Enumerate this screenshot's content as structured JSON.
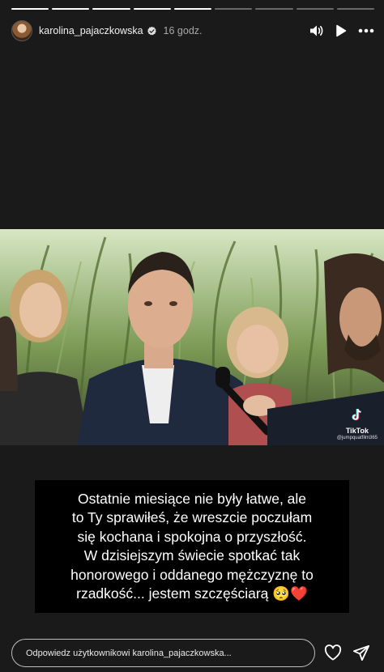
{
  "story": {
    "segments_total": 9,
    "segments_viewed": 5
  },
  "header": {
    "username": "karolina_pajaczkowska",
    "time": "16 godz.",
    "verified": true,
    "icons": [
      "sound-icon",
      "play-icon",
      "more-icon"
    ]
  },
  "video": {
    "watermark_app": "TikTok",
    "watermark_handle": "@jumpquatfilm365"
  },
  "caption": {
    "lines": [
      "Ostatnie miesiące nie były łatwe, ale",
      "to Ty sprawiłeś, że wreszcie poczułam",
      "się kochana i spokojna o przyszłość.",
      "W dzisiejszym świecie spotkać tak",
      "honorowego i oddanego mężczyznę to",
      "rzadkość... jestem szczęściarą 🥺❤️"
    ]
  },
  "footer": {
    "reply_placeholder": "Odpowiedz użytkownikowi karolina_pajaczkowska...",
    "icons": [
      "heart-icon",
      "share-icon"
    ]
  },
  "colors": {
    "background": "#1a1a1a",
    "caption_background": "#000000",
    "progress_active": "#ffffff"
  }
}
